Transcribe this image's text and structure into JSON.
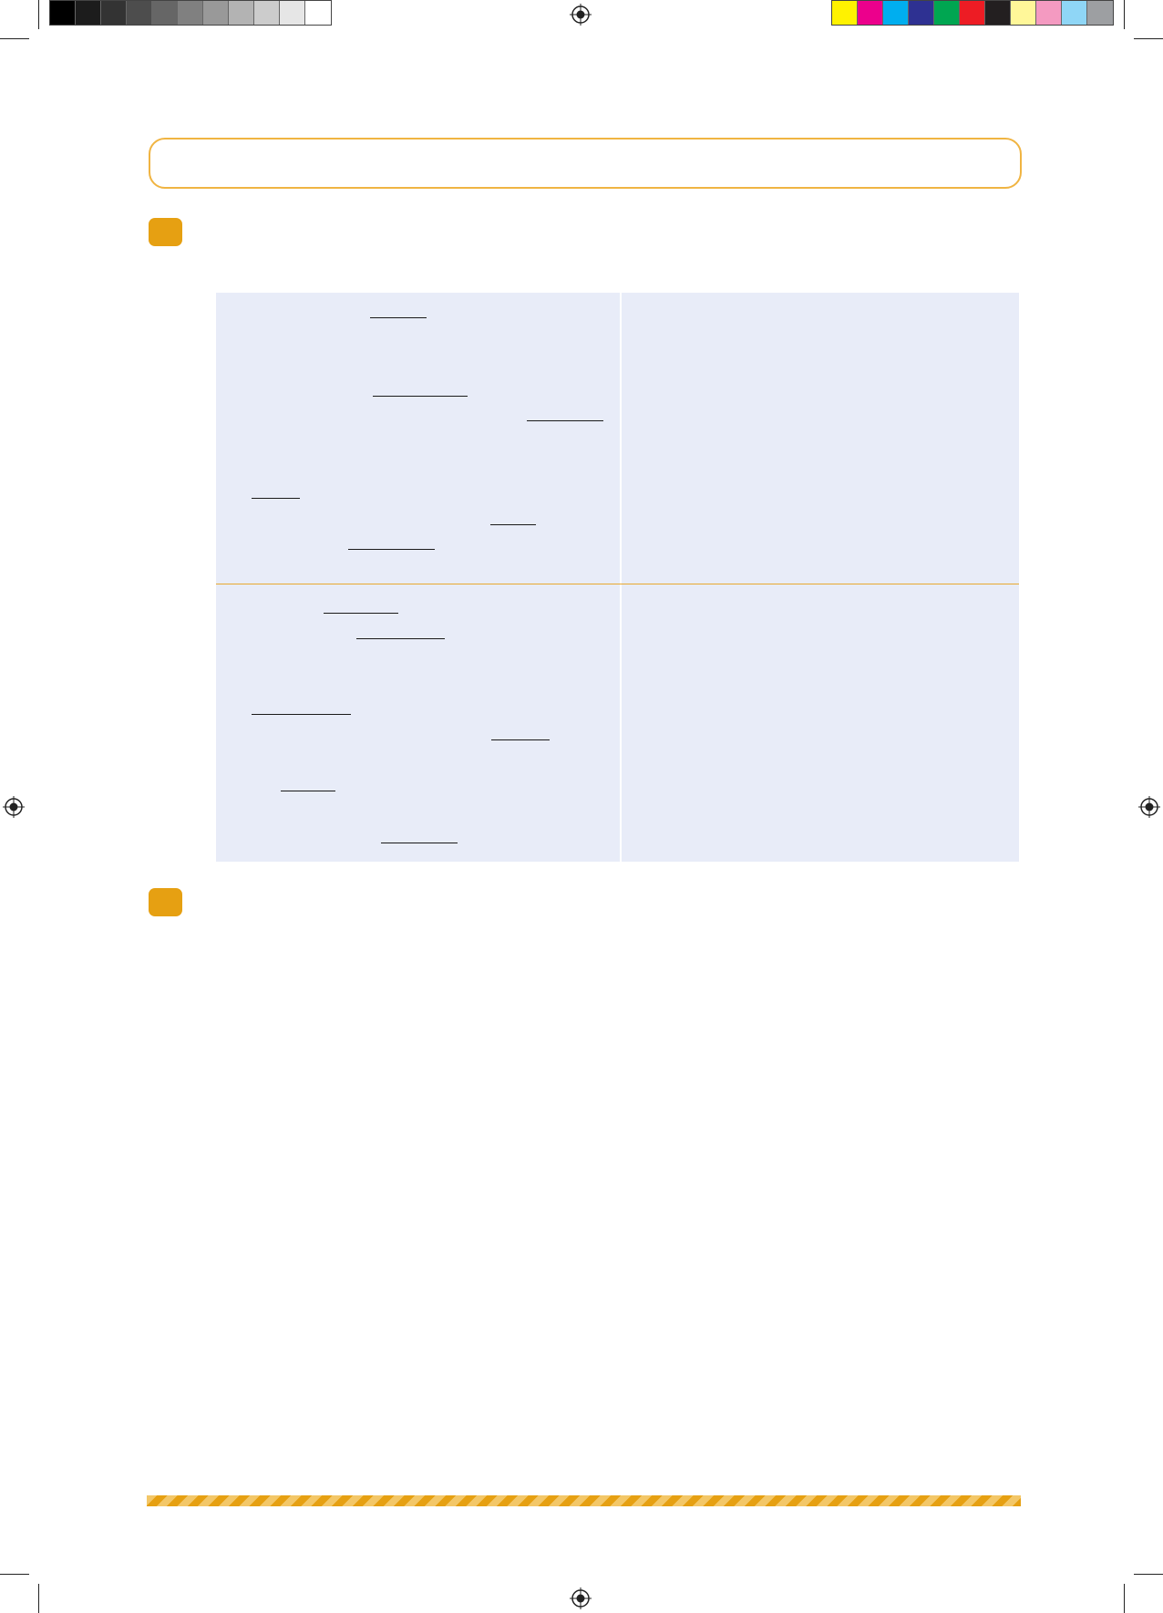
{
  "print_marks": {
    "gray_swatches": [
      "#000000",
      "#1c1c1c",
      "#333333",
      "#4d4d4d",
      "#666666",
      "#808080",
      "#999999",
      "#b3b3b3",
      "#cccccc",
      "#e6e6e6",
      "#ffffff"
    ],
    "color_swatches": [
      "#fff200",
      "#ec008c",
      "#00aeef",
      "#2e3192",
      "#00a651",
      "#ed1c24",
      "#231f20",
      "#fff799",
      "#f49ac1",
      "#8fd6f6",
      "#9d9fa2"
    ]
  },
  "colors": {
    "accent": "#e6a012",
    "title_border": "#f0b442",
    "table_fill": "#e8ecf8",
    "row_rule": "#e8a830"
  },
  "title_box": {
    "text": ""
  },
  "exercises": [
    {
      "number": ""
    },
    {
      "number": ""
    }
  ]
}
